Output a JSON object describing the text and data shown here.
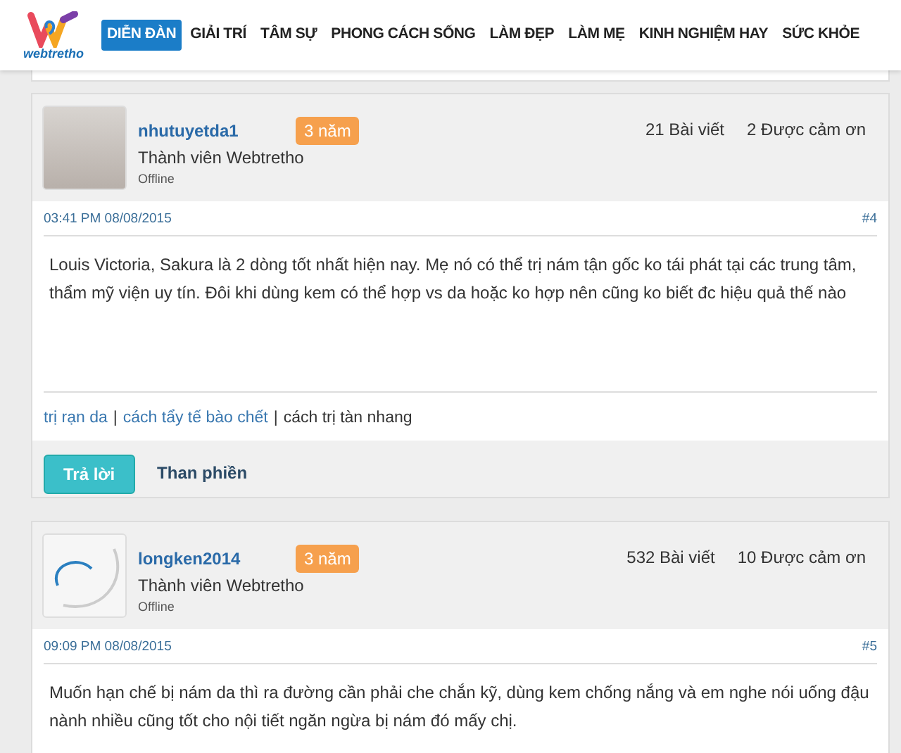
{
  "header": {
    "logo_text": "webtretho",
    "nav": [
      {
        "label": "DIỄN ĐÀN",
        "selected": true
      },
      {
        "label": "GIẢI TRÍ",
        "selected": false
      },
      {
        "label": "TÂM SỰ",
        "selected": false
      },
      {
        "label": "PHONG CÁCH SỐNG",
        "selected": false
      },
      {
        "label": "LÀM ĐẸP",
        "selected": false
      },
      {
        "label": "LÀM MẸ",
        "selected": false
      },
      {
        "label": "KINH NGHIỆM HAY",
        "selected": false
      },
      {
        "label": "SỨC KHỎE",
        "selected": false
      }
    ]
  },
  "posts": [
    {
      "username": "nhutuyetda1",
      "badge": "3 năm",
      "role": "Thành viên Webtretho",
      "status": "Offline",
      "avatar": {
        "kind": "photo"
      },
      "posts_count": "21 Bài viết",
      "thanks": "2 Được cảm ơn",
      "time": "03:41 PM 08/08/2015",
      "number": "#4",
      "body": "Louis Victoria, Sakura là 2 dòng tốt nhất hiện nay. Mẹ nó có thể trị nám tận gốc ko tái phát tại các trung tâm, thẩm mỹ viện uy tín. Đôi khi dùng kem có thể hợp vs da hoặc ko hợp nên cũng ko biết đc hiệu quả thế nào",
      "signature": [
        {
          "kind": "link",
          "text": "trị rạn da"
        },
        {
          "kind": "separator",
          "text": "|"
        },
        {
          "kind": "link",
          "text": "cách tẩy tế bào chết"
        },
        {
          "kind": "separator",
          "text": "|"
        },
        {
          "kind": "text",
          "text": "cách trị tàn nhang"
        }
      ],
      "actions": [
        {
          "kind": "primary",
          "label": "Trả lời"
        },
        {
          "kind": "plain",
          "label": "Than phiền"
        }
      ]
    },
    {
      "username": "longken2014",
      "badge": "3 năm",
      "role": "Thành viên Webtretho",
      "status": "Offline",
      "avatar": {
        "kind": "logo"
      },
      "posts_count": "532 Bài viết",
      "thanks": "10 Được cảm ơn",
      "time": "09:09 PM 08/08/2015",
      "number": "#5",
      "body": "Muốn hạn chế bị nám da thì ra đường cần phải che chắn kỹ, dùng kem chống nắng và em nghe nói uống đậu nành nhiều cũng tốt cho nội tiết ngăn ngừa bị nám đó mấy chị."
    }
  ]
}
